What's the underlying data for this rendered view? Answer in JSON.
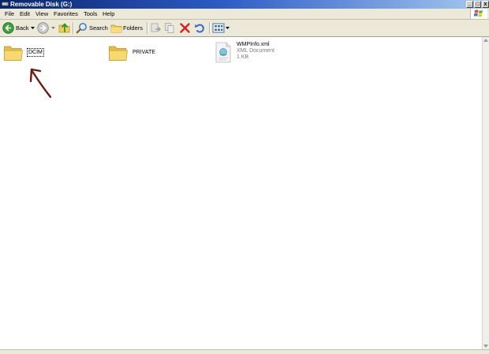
{
  "window": {
    "title": "Removable Disk (G:)",
    "controls": {
      "minimize": "_",
      "maximize": "□",
      "close": "x"
    }
  },
  "menu": {
    "items": [
      {
        "label": "File"
      },
      {
        "label": "Edit"
      },
      {
        "label": "View"
      },
      {
        "label": "Favorites"
      },
      {
        "label": "Tools"
      },
      {
        "label": "Help"
      }
    ]
  },
  "toolbar": {
    "back_label": "Back",
    "search_label": "Search",
    "folders_label": "Folders",
    "icons": [
      "back-arrow-icon",
      "forward-arrow-icon",
      "up-folder-icon",
      "search-icon",
      "folders-icon",
      "move-to-icon",
      "copy-to-icon",
      "delete-icon",
      "undo-icon",
      "views-icon"
    ]
  },
  "files": [
    {
      "name": "DCIM",
      "type": "folder"
    },
    {
      "name": "PRIVATE",
      "type": "folder"
    },
    {
      "name": "WMPInfo.xml",
      "type": "file",
      "subtitle": "XML Document",
      "size": "1 KB"
    }
  ],
  "colors": {
    "titlebar_start": "#0a246a",
    "titlebar_end": "#a6caf0",
    "chrome": "#ece9d8",
    "folder": "#f5d76e",
    "delete": "#d42020",
    "annotation": "#6b1a10"
  }
}
